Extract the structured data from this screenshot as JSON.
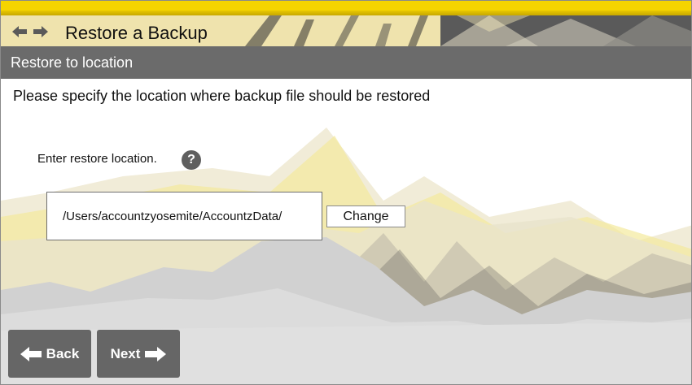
{
  "header": {
    "title": "Restore a Backup",
    "colors": {
      "stripe": "#f5d400",
      "subheader": "#6b6b6b",
      "button": "#666666"
    }
  },
  "subheader": {
    "title": "Restore to location"
  },
  "main": {
    "instruction": "Please specify the location where backup file should be restored",
    "prompt_label": "Enter restore location.",
    "help_icon": "question-mark-icon",
    "help_glyph": "?",
    "location_path": "/Users/accountzyosemite/AccountzData/",
    "change_label": "Change"
  },
  "footer": {
    "back_label": "Back",
    "next_label": "Next"
  }
}
